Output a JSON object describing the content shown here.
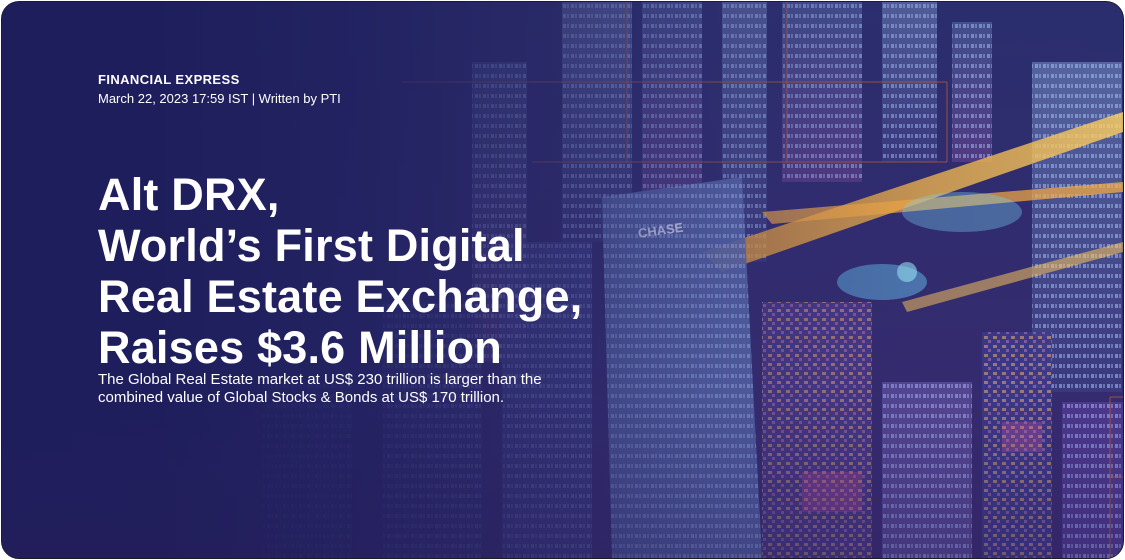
{
  "article": {
    "source": "FINANCIAL EXPRESS",
    "meta": "March 22, 2023 17:59 IST | Written by PTI",
    "headline_lines": [
      "Alt DRX,",
      "World’s First Digital",
      "Real Estate Exchange,",
      "Raises $3.6 Million"
    ],
    "summary_lines": [
      "The Global Real Estate market at US$ 230 trillion is larger than the",
      "combined value of Global Stocks & Bonds at US$ 170 trillion."
    ],
    "building_sign": "CHASE"
  },
  "colors": {
    "overlay": "#1e1e5c",
    "accent_grid": "#c8602e",
    "text": "#ffffff"
  }
}
